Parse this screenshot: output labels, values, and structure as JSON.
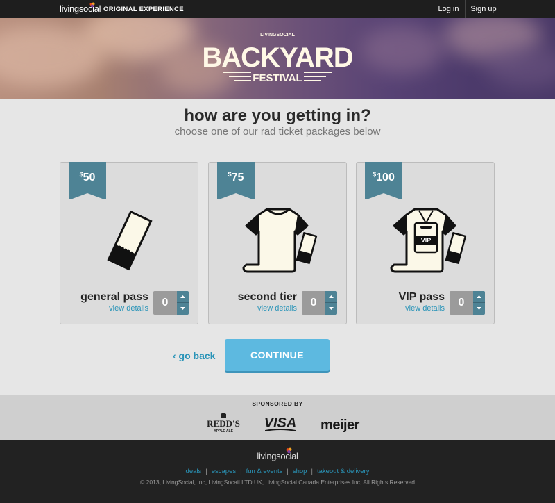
{
  "topbar": {
    "logo": "livingsocial",
    "tagline": "ORIGINAL EXPERIENCE",
    "login": "Log in",
    "signup": "Sign up"
  },
  "hero": {
    "presenter": "LIVINGSOCIAL",
    "title": "BACKYARD",
    "subtitle": "FESTIVAL"
  },
  "heading": {
    "title": "how are you getting in?",
    "subtitle": "choose one of our rad ticket packages below"
  },
  "packages": [
    {
      "currency": "$",
      "amount": "50",
      "name": "general pass",
      "details": "view details",
      "quantity": "0",
      "icon": "ticket-icon"
    },
    {
      "currency": "$",
      "amount": "75",
      "name": "second tier",
      "details": "view details",
      "quantity": "0",
      "icon": "tshirt-ticket-icon"
    },
    {
      "currency": "$",
      "amount": "100",
      "name": "VIP pass",
      "details": "view details",
      "quantity": "0",
      "icon": "vip-tshirt-ticket-icon",
      "badge": "VIP"
    }
  ],
  "actions": {
    "back": "‹ go back",
    "continue": "CONTINUE"
  },
  "sponsors": {
    "label": "SPONSORED BY",
    "logos": [
      "REDD'S",
      "APPLE ALE",
      "VISA",
      "meijer"
    ]
  },
  "footer": {
    "logo": "livingsocial",
    "links": [
      "deals",
      "escapes",
      "fun & events",
      "shop",
      "takeout & delivery"
    ],
    "separator": "|",
    "copyright": "© 2013, LivingSocial, Inc, LivingSocail LTD UK, LivingSocial Canada Enterprises Inc, All Rights Reserved"
  },
  "colors": {
    "accent": "#2a94b8",
    "ribbon": "#4e8395",
    "continue": "#5db9e0",
    "topbar": "#1e1e1e"
  }
}
